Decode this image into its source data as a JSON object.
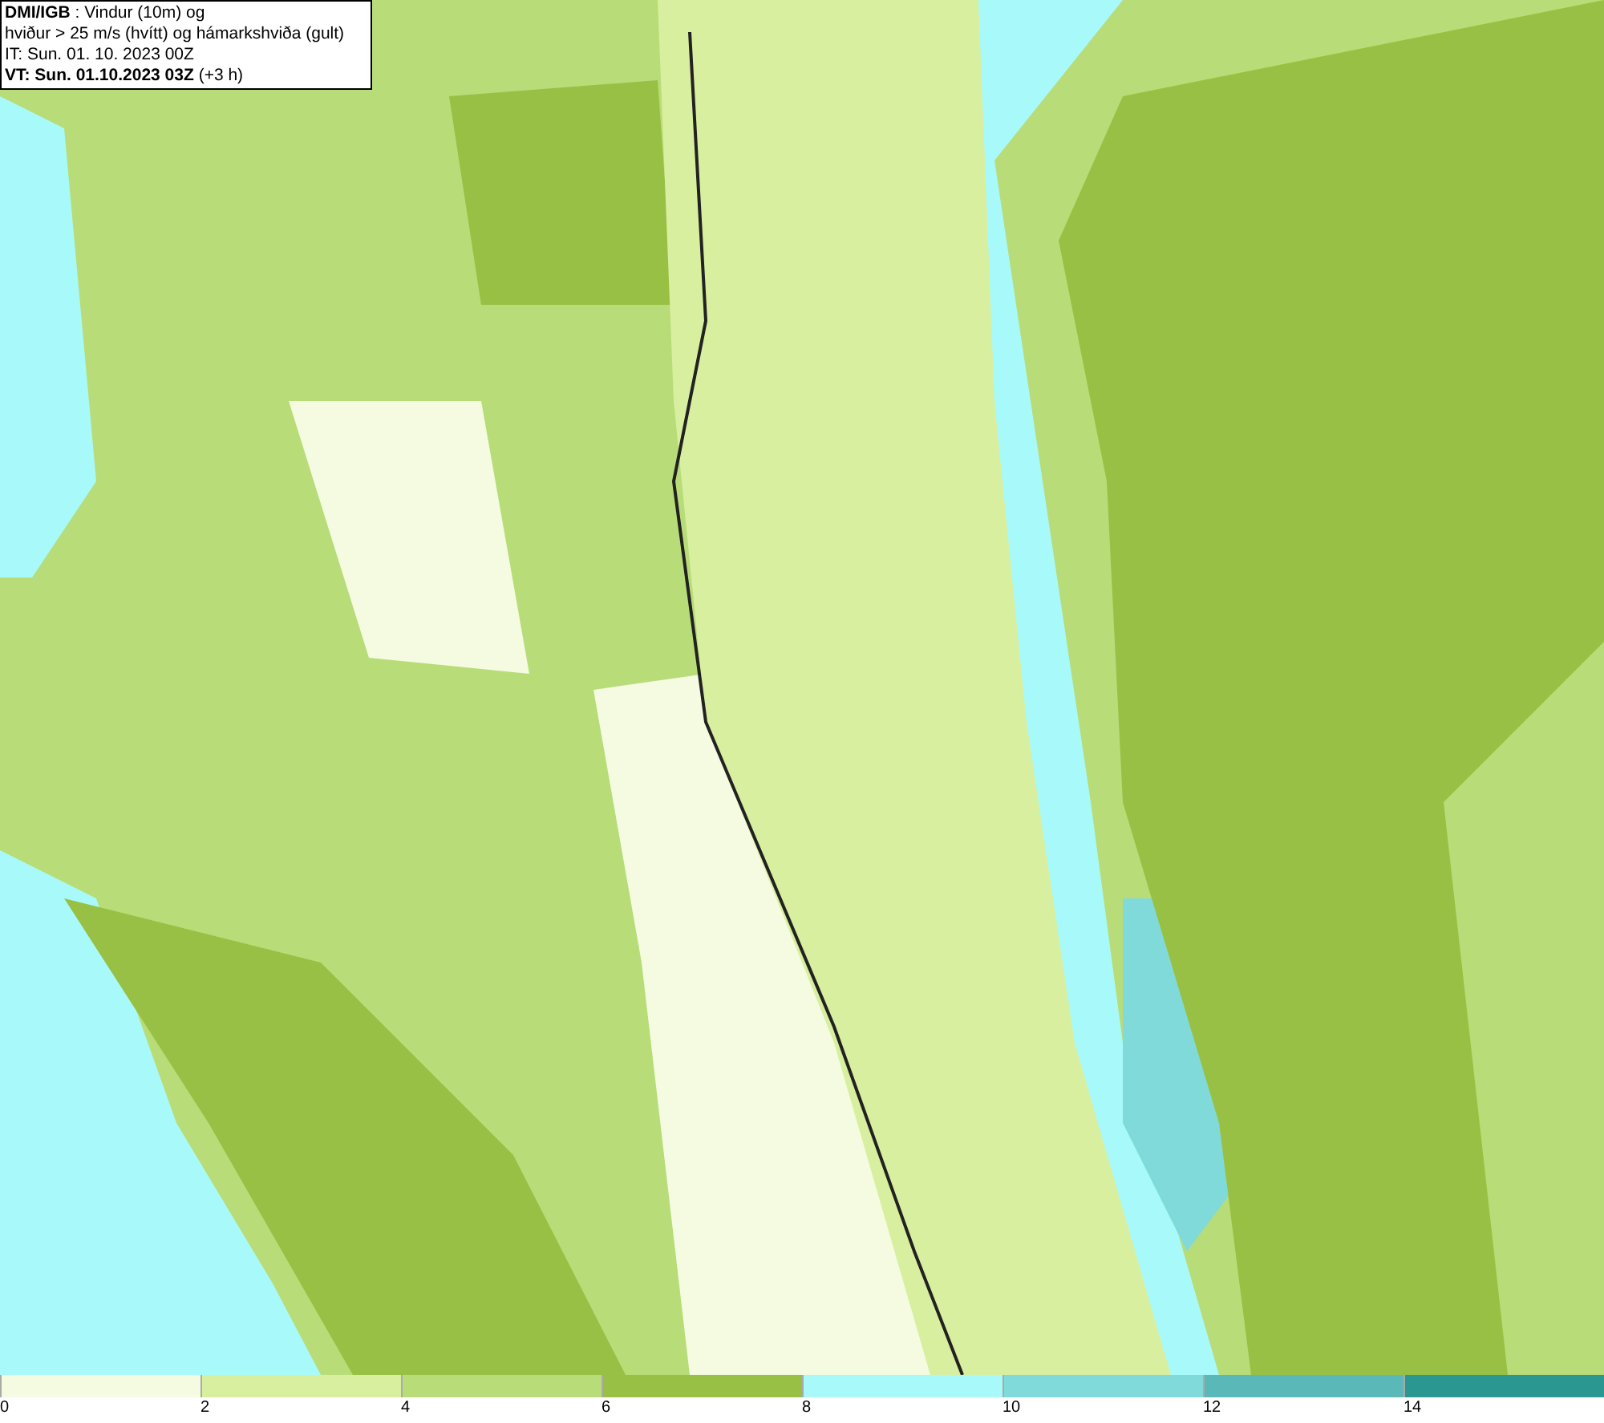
{
  "title_box": {
    "lines": [
      "**DMI/IGB** : Vindur (10m) og",
      "hviður > 25 m/s (hvítt) og hámarkshviða (gult)",
      "IT: Sun. 01. 10. 2023 00Z",
      "**VT: Sun. 01.10.2023 03Z** (+3 h)"
    ]
  },
  "legend": {
    "swatches": [
      {
        "color": "#f4fbe0"
      },
      {
        "color": "#d8ef9f"
      },
      {
        "color": "#b8dc78"
      },
      {
        "color": "#98c044"
      },
      {
        "color": "#a8fafa"
      },
      {
        "color": "#80dada"
      },
      {
        "color": "#5ab8b8"
      },
      {
        "color": "#2a9890"
      }
    ],
    "ticks": [
      "0",
      "2",
      "4",
      "6",
      "8",
      "10",
      "12",
      "14"
    ]
  }
}
